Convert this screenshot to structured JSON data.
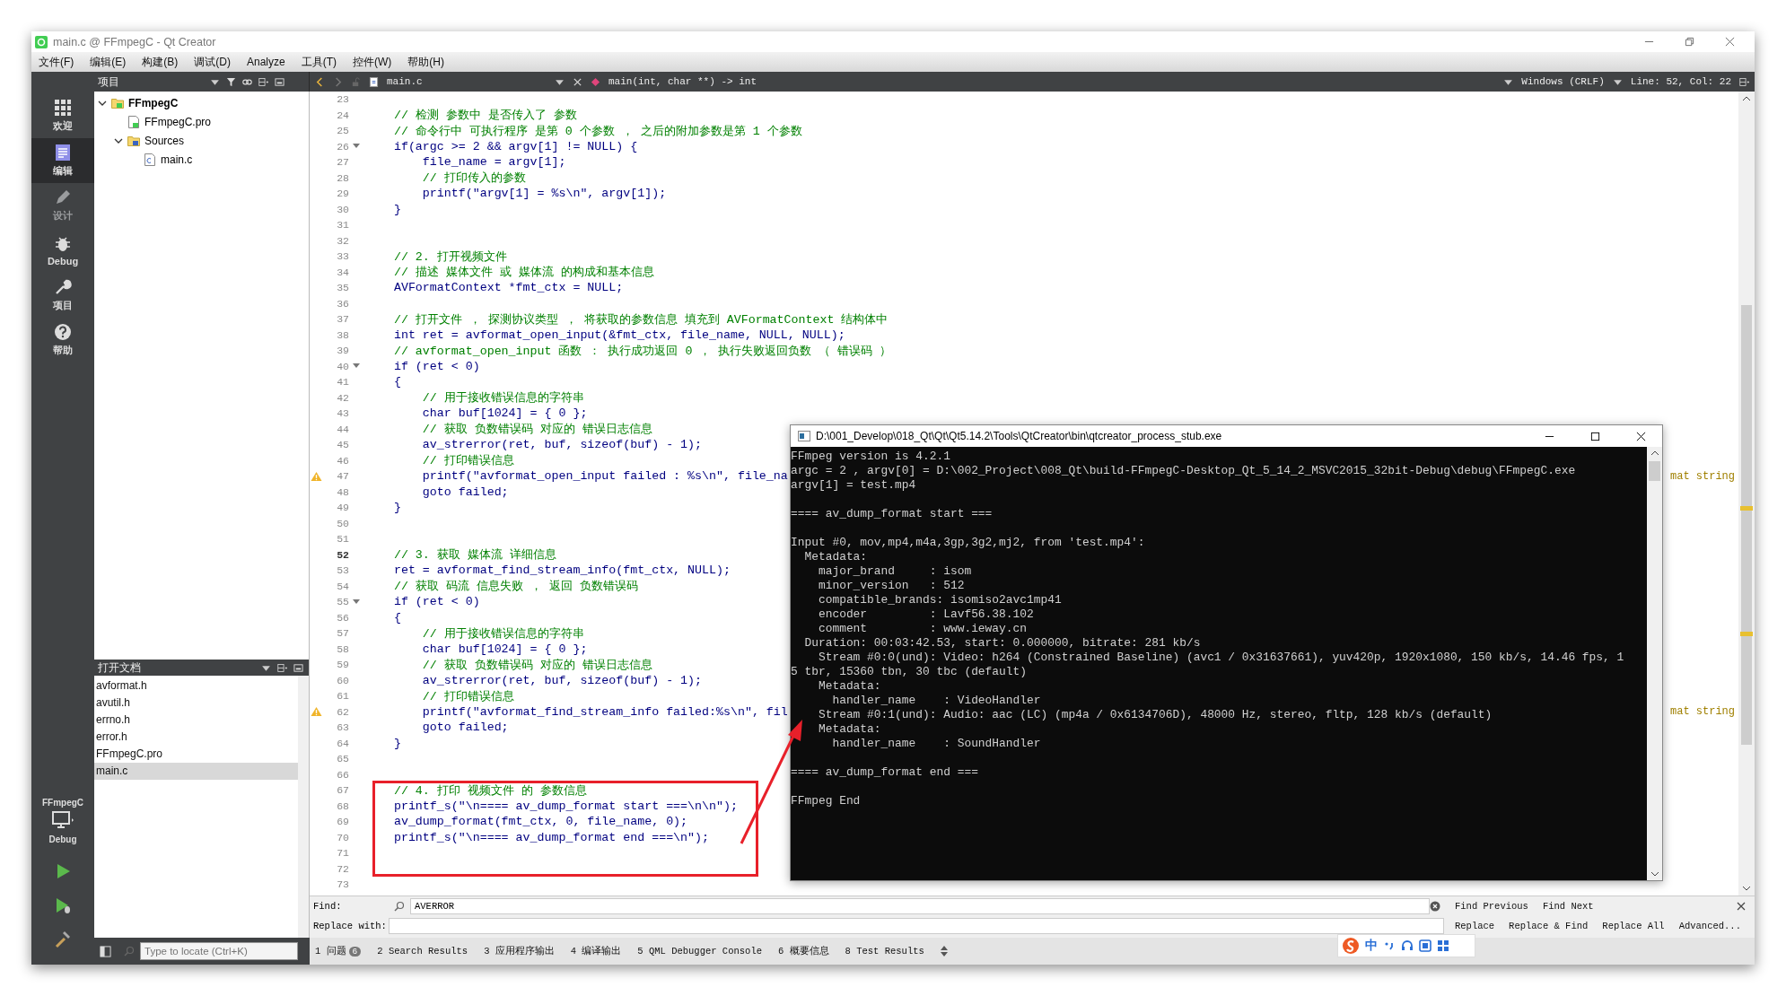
{
  "window": {
    "title": "main.c @ FFmpegC - Qt Creator"
  },
  "menu": [
    "文件(F)",
    "编辑(E)",
    "构建(B)",
    "调试(D)",
    "Analyze",
    "工具(T)",
    "控件(W)",
    "帮助(H)"
  ],
  "mode_bar": {
    "items": [
      {
        "label": "欢迎",
        "kind": "welcome",
        "selected": false,
        "disabled": false
      },
      {
        "label": "编辑",
        "kind": "edit",
        "selected": true,
        "disabled": false
      },
      {
        "label": "设计",
        "kind": "design",
        "selected": false,
        "disabled": true
      },
      {
        "label": "Debug",
        "kind": "debug",
        "selected": false,
        "disabled": false
      },
      {
        "label": "项目",
        "kind": "projects",
        "selected": false,
        "disabled": false
      },
      {
        "label": "帮助",
        "kind": "help",
        "selected": false,
        "disabled": false
      }
    ],
    "kit": {
      "project": "FFmpegC",
      "build": "Debug"
    }
  },
  "project_panel": {
    "title": "项目",
    "tree": [
      {
        "label": "FFmpegC",
        "kind": "project",
        "expanded": true,
        "children": [
          {
            "label": "FFmpegC.pro",
            "kind": "pro"
          },
          {
            "label": "Sources",
            "kind": "folder",
            "expanded": true,
            "children": [
              {
                "label": "main.c",
                "kind": "c"
              }
            ]
          }
        ]
      }
    ]
  },
  "open_documents": {
    "title": "打开文档",
    "items": [
      {
        "label": "avformat.h",
        "selected": false
      },
      {
        "label": "avutil.h",
        "selected": false
      },
      {
        "label": "errno.h",
        "selected": false
      },
      {
        "label": "error.h",
        "selected": false
      },
      {
        "label": "FFmpegC.pro",
        "selected": false
      },
      {
        "label": "main.c",
        "selected": true
      }
    ]
  },
  "editor_toolbar": {
    "file": "main.c",
    "symbol": "main(int, char **) -> int",
    "line_ending": "Windows (CRLF)",
    "position": "Line: 52, Col: 22"
  },
  "code_lines": [
    {
      "number": "23"
    },
    {
      "number": "24",
      "kind": "comment",
      "text": "    // 检测 参数中 是否传入了 参数"
    },
    {
      "number": "25",
      "kind": "comment",
      "text": "    // 命令行中 可执行程序 是第 0 个参数 ， 之后的附加参数是第 1 个参数"
    },
    {
      "number": "26",
      "kind": "code",
      "fold": true,
      "text": "    if(argc >= 2 && argv[1] != NULL) {"
    },
    {
      "number": "27",
      "kind": "code",
      "text": "        file_name = argv[1];"
    },
    {
      "number": "28",
      "kind": "comment",
      "text": "        // 打印传入的参数"
    },
    {
      "number": "29",
      "kind": "code",
      "text": "        printf(\"argv[1] = %s\\n\", argv[1]);"
    },
    {
      "number": "30",
      "kind": "code",
      "text": "    }"
    },
    {
      "number": "31"
    },
    {
      "number": "32"
    },
    {
      "number": "33",
      "kind": "comment",
      "text": "    // 2. 打开视频文件"
    },
    {
      "number": "34",
      "kind": "comment",
      "text": "    // 描述 媒体文件 或 媒体流 的构成和基本信息"
    },
    {
      "number": "35",
      "kind": "code",
      "text": "    AVFormatContext *fmt_ctx = NULL;"
    },
    {
      "number": "36"
    },
    {
      "number": "37",
      "kind": "comment",
      "text": "    // 打开文件 ， 探测协议类型 ， 将获取的参数信息 填充到 AVFormatContext 结构体中"
    },
    {
      "number": "38",
      "kind": "code",
      "text": "    int ret = avformat_open_input(&fmt_ctx, file_name, NULL, NULL);"
    },
    {
      "number": "39",
      "kind": "comment",
      "text": "    // avformat_open_input 函数 ： 执行成功返回 0 ， 执行失败返回负数 （ 错误码 ）"
    },
    {
      "number": "40",
      "kind": "code",
      "fold": true,
      "text": "    if (ret < 0)"
    },
    {
      "number": "41",
      "kind": "code",
      "text": "    {"
    },
    {
      "number": "42",
      "kind": "comment",
      "text": "        // 用于接收错误信息的字符串"
    },
    {
      "number": "43",
      "kind": "code",
      "text": "        char buf[1024] = { 0 };"
    },
    {
      "number": "44",
      "kind": "comment",
      "text": "        // 获取 负数错误码 对应的 错误日志信息"
    },
    {
      "number": "45",
      "kind": "code",
      "text": "        av_strerror(ret, buf, sizeof(buf) - 1);"
    },
    {
      "number": "46",
      "kind": "comment",
      "text": "        // 打印错误信息"
    },
    {
      "number": "47",
      "kind": "code",
      "warning": true,
      "text": "        printf(\"avformat_open_input failed : %s\\n\", file_na",
      "annotation": "mat string"
    },
    {
      "number": "48",
      "kind": "code",
      "text": "        goto failed;"
    },
    {
      "number": "49",
      "kind": "code",
      "text": "    }"
    },
    {
      "number": "50"
    },
    {
      "number": "51"
    },
    {
      "number": "52",
      "kind": "comment",
      "current": true,
      "text": "    // 3. 获取 媒体流 详细信息"
    },
    {
      "number": "53",
      "kind": "code",
      "text": "    ret = avformat_find_stream_info(fmt_ctx, NULL);"
    },
    {
      "number": "54",
      "kind": "comment",
      "text": "    // 获取 码流 信息失败 ， 返回 负数错误码"
    },
    {
      "number": "55",
      "kind": "code",
      "fold": true,
      "text": "    if (ret < 0)"
    },
    {
      "number": "56",
      "kind": "code",
      "text": "    {"
    },
    {
      "number": "57",
      "kind": "comment",
      "text": "        // 用于接收错误信息的字符串"
    },
    {
      "number": "58",
      "kind": "code",
      "text": "        char buf[1024] = { 0 };"
    },
    {
      "number": "59",
      "kind": "comment",
      "text": "        // 获取 负数错误码 对应的 错误日志信息"
    },
    {
      "number": "60",
      "kind": "code",
      "text": "        av_strerror(ret, buf, sizeof(buf) - 1);"
    },
    {
      "number": "61",
      "kind": "comment",
      "text": "        // 打印错误信息"
    },
    {
      "number": "62",
      "kind": "code",
      "warning": true,
      "text": "        printf(\"avformat_find_stream_info failed:%s\\n\", fil",
      "annotation": "mat string"
    },
    {
      "number": "63",
      "kind": "code",
      "text": "        goto failed;"
    },
    {
      "number": "64",
      "kind": "code",
      "text": "    }"
    },
    {
      "number": "65"
    },
    {
      "number": "66"
    },
    {
      "number": "67",
      "kind": "comment",
      "text": "    // 4. 打印 视频文件 的 参数信息"
    },
    {
      "number": "68",
      "kind": "code",
      "text": "    printf_s(\"\\n==== av_dump_format start ===\\n\\n\");"
    },
    {
      "number": "69",
      "kind": "code",
      "text": "    av_dump_format(fmt_ctx, 0, file_name, 0);"
    },
    {
      "number": "70",
      "kind": "code",
      "text": "    printf_s(\"\\n==== av_dump_format end ===\\n\");"
    },
    {
      "number": "71"
    },
    {
      "number": "72"
    },
    {
      "number": "73"
    }
  ],
  "console": {
    "title": "D:\\001_Develop\\018_Qt\\Qt\\Qt5.14.2\\Tools\\QtCreator\\bin\\qtcreator_process_stub.exe",
    "blocks": [
      [
        "FFmpeg version is 4.2.1",
        "argc = 2 , argv[0] = D:\\002_Project\\008_Qt\\build-FFmpegC-Desktop_Qt_5_14_2_MSVC2015_32bit-Debug\\debug\\FFmpegC.exe",
        "argv[1] = test.mp4"
      ],
      [
        "==== av_dump_format start ==="
      ],
      [
        "Input #0, mov,mp4,m4a,3gp,3g2,mj2, from 'test.mp4':",
        "  Metadata:",
        "    major_brand     : isom",
        "    minor_version   : 512",
        "    compatible_brands: isomiso2avc1mp41",
        "    encoder         : Lavf56.38.102",
        "    comment         : www.ieway.cn",
        "  Duration: 00:03:42.53, start: 0.000000, bitrate: 281 kb/s",
        "    Stream #0:0(und): Video: h264 (Constrained Baseline) (avc1 / 0x31637661), yuv420p, 1920x1080, 150 kb/s, 14.46 fps, 1",
        "5 tbr, 15360 tbn, 30 tbc (default)",
        "    Metadata:",
        "      handler_name    : VideoHandler",
        "    Stream #0:1(und): Audio: aac (LC) (mp4a / 0x6134706D), 48000 Hz, stereo, fltp, 128 kb/s (default)",
        "    Metadata:",
        "      handler_name    : SoundHandler"
      ],
      [
        "==== av_dump_format end ==="
      ],
      [
        "FFmpeg End"
      ]
    ]
  },
  "find_bar": {
    "find_label": "Find:",
    "find_value": "AVERROR",
    "replace_label": "Replace with:",
    "find_buttons": [
      "Find Previous",
      "Find Next"
    ],
    "replace_buttons": [
      "Replace",
      "Replace & Find",
      "Replace All",
      "Advanced..."
    ]
  },
  "status_bar": {
    "locate_placeholder": "Type to locate (Ctrl+K)",
    "tabs": [
      {
        "label": "1 问题",
        "badge": "6"
      },
      {
        "label": "2 Search Results"
      },
      {
        "label": "3 应用程序输出"
      },
      {
        "label": "4 编译输出"
      },
      {
        "label": "5 QML Debugger Console"
      },
      {
        "label": "6 概要信息"
      },
      {
        "label": "8 Test Results"
      }
    ]
  },
  "ime_bar": {
    "mode": "中"
  }
}
